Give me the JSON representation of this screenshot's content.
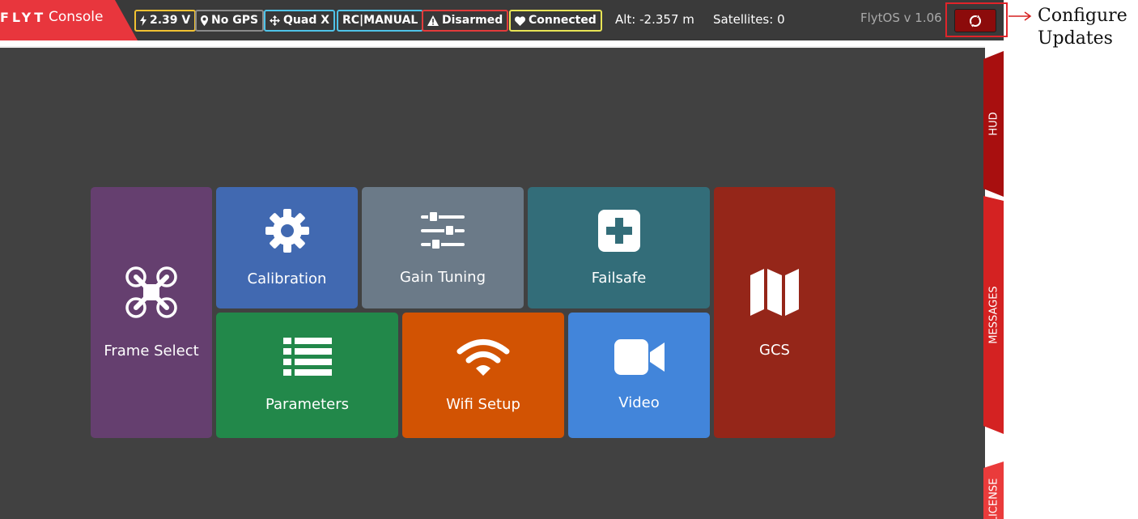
{
  "header": {
    "logo_brand": "FLYT",
    "logo_sub": "Console",
    "badges": {
      "voltage": "2.39 V",
      "gps": "No GPS",
      "frame": "Quad X",
      "mode": "RC|MANUAL",
      "arm": "Disarmed",
      "link": "Connected"
    },
    "altitude": "Alt: -2.357 m",
    "satellites": "Satellites: 0",
    "version": "FlytOS v 1.06"
  },
  "tiles": {
    "frame_select": "Frame Select",
    "calibration": "Calibration",
    "gain_tuning": "Gain Tuning",
    "failsafe": "Failsafe",
    "gcs": "GCS",
    "parameters": "Parameters",
    "wifi_setup": "Wifi Setup",
    "video": "Video"
  },
  "side_tabs": {
    "hud": "HUD",
    "messages": "MESSAGES",
    "license": "LICENSE"
  },
  "annotation": {
    "line1": "Configure",
    "line2": "Updates"
  },
  "colors": {
    "brand_red": "#e8363d",
    "frame_select": "#653f6f",
    "calibration": "#4169b1",
    "gain_tuning": "#6b7a88",
    "failsafe": "#336d79",
    "gcs": "#952619",
    "parameters": "#22884a",
    "wifi_setup": "#d25303",
    "video": "#4285da"
  }
}
